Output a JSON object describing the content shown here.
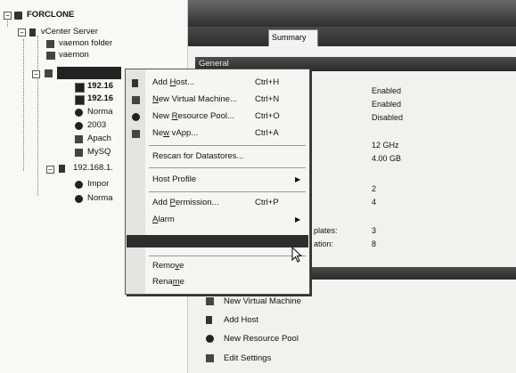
{
  "tree": {
    "root": "FORCLONE",
    "vcenter": "vCenter Server",
    "folder": "vaemon folder",
    "vaemon": "vaemon",
    "host_ip_partial_1": "192.16",
    "host_ip_partial_2": "192.16",
    "normal_partial": "Norma",
    "vm_2003": "2003",
    "apache_partial": "Apach",
    "mysql_partial": "MySQ",
    "host2": "192.168.1.",
    "import_partial": "Impor",
    "normal2_partial": "Norma"
  },
  "right": {
    "active_tab": "Summary",
    "section_title": "General",
    "values": [
      "Enabled",
      "Enabled",
      "Disabled",
      "12 GHz",
      "4.00 GB",
      "2",
      "4",
      "3",
      "8"
    ],
    "label_templates": "plates:",
    "label_ation": "ation:",
    "commands": [
      {
        "label": "New Virtual Machine",
        "icon": "new-vm-icon"
      },
      {
        "label": "Add Host",
        "icon": "add-host-icon"
      },
      {
        "label": "New Resource Pool",
        "icon": "resource-pool-icon"
      },
      {
        "label": "Edit Settings",
        "icon": "settings-icon"
      }
    ]
  },
  "menu": {
    "add_host": {
      "pre": "Add ",
      "ul": "H",
      "post": "ost...",
      "shortcut": "Ctrl+H"
    },
    "new_vm": {
      "pre": "",
      "ul": "N",
      "post": "ew Virtual Machine...",
      "shortcut": "Ctrl+N"
    },
    "new_rp": {
      "pre": "New ",
      "ul": "R",
      "post": "esource Pool...",
      "shortcut": "Ctrl+O"
    },
    "new_vapp": {
      "pre": "Ne",
      "ul": "w",
      "post": " vApp...",
      "shortcut": "Ctrl+A"
    },
    "rescan": "Rescan for Datastores...",
    "host_profile": "Host Profile",
    "add_perm": {
      "pre": "Add ",
      "ul": "P",
      "post": "ermission...",
      "shortcut": "Ctrl+P"
    },
    "alarm": {
      "pre": "",
      "ul": "A",
      "post": "larm"
    },
    "remove": {
      "pre": "Remo",
      "ul": "v",
      "post": "e"
    },
    "rename": {
      "pre": "Rena",
      "ul": "m",
      "post": "e"
    }
  }
}
